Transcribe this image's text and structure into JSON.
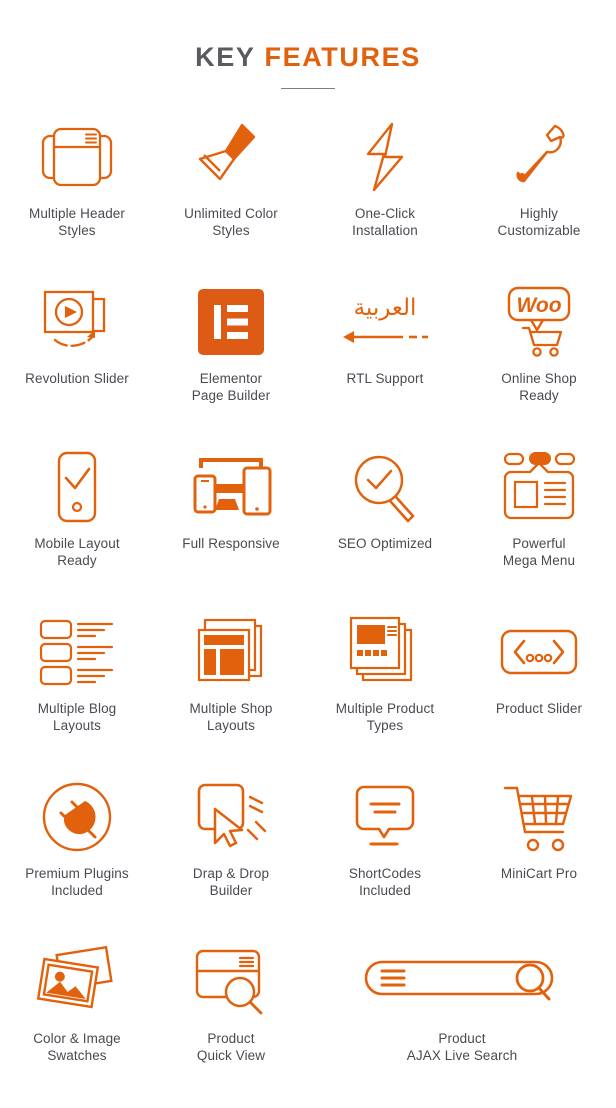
{
  "header": {
    "title_part1": "KEY",
    "title_part2": "FEATURES"
  },
  "colors": {
    "accent": "#e2610d",
    "accent_fill": "#dd5b14",
    "title_gray": "#5a5a5f",
    "label_gray": "#4a4a52",
    "background": "#ffffff",
    "rule": "#7d7d82"
  },
  "features": [
    {
      "icon": "multiple-header-styles-icon",
      "label": "Multiple Header\nStyles"
    },
    {
      "icon": "paint-roller-icon",
      "label": "Unlimited Color\nStyles"
    },
    {
      "icon": "lightning-bolt-icon",
      "label": "One-Click\nInstallation"
    },
    {
      "icon": "wrench-icon",
      "label": "Highly\nCustomizable"
    },
    {
      "icon": "revolution-slider-icon",
      "label": "Revolution Slider"
    },
    {
      "icon": "elementor-logo-icon",
      "label": "Elementor\nPage Builder"
    },
    {
      "icon": "rtl-arrow-icon",
      "label": "RTL Support",
      "arabic_text": "العربية"
    },
    {
      "icon": "woocommerce-cart-icon",
      "label": "Online Shop\nReady",
      "badge_text": "Woo"
    },
    {
      "icon": "mobile-check-icon",
      "label": "Mobile Layout\nReady"
    },
    {
      "icon": "responsive-devices-icon",
      "label": "Full Responsive"
    },
    {
      "icon": "magnifier-check-icon",
      "label": "SEO Optimized"
    },
    {
      "icon": "mega-menu-icon",
      "label": "Powerful\nMega Menu"
    },
    {
      "icon": "blog-list-layout-icon",
      "label": "Multiple Blog\nLayouts"
    },
    {
      "icon": "stacked-pages-icon",
      "label": "Multiple Shop\nLayouts"
    },
    {
      "icon": "product-cards-icon",
      "label": "Multiple Product\nTypes"
    },
    {
      "icon": "slider-arrows-icon",
      "label": "Product Slider"
    },
    {
      "icon": "plug-circle-icon",
      "label": "Premium Plugins\nIncluded"
    },
    {
      "icon": "drag-drop-cursor-icon",
      "label": "Drap & Drop\nBuilder"
    },
    {
      "icon": "speech-bubble-icon",
      "label": "ShortCodes\nIncluded"
    },
    {
      "icon": "shopping-cart-icon",
      "label": "MiniCart Pro"
    },
    {
      "icon": "photo-stack-icon",
      "label": "Color & Image\nSwatches"
    },
    {
      "icon": "quick-view-card-icon",
      "label": "Product\nQuick View"
    },
    {
      "icon": "ajax-search-bar-icon",
      "label": "Product\nAJAX Live Search"
    }
  ]
}
